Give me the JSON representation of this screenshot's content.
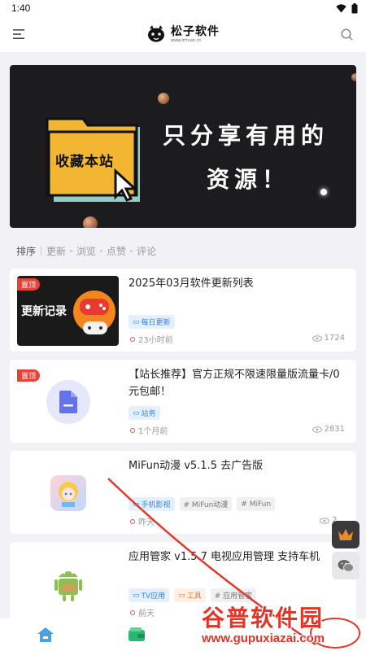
{
  "status": {
    "time": "1:40"
  },
  "header": {
    "title": "松子软件",
    "subtitle": "www.lrfruan.cn"
  },
  "banner": {
    "folder_label": "收藏本站",
    "line1": "只分享有用的",
    "line2": "资源！"
  },
  "sort": {
    "label": "排序",
    "options": [
      "更新",
      "浏览",
      "点赞",
      "评论"
    ]
  },
  "pin_label": "置顶",
  "posts": [
    {
      "title": "2025年03月软件更新列表",
      "thumb_text": "更新记录",
      "tags": [
        "每日更新"
      ],
      "time": "23小时前",
      "views": "1724",
      "pinned": true
    },
    {
      "title": "【站长推荐】官方正规不限速限量版流量卡/0元包邮！",
      "tags": [
        "站务"
      ],
      "time": "1个月前",
      "views": "2831",
      "pinned": true
    },
    {
      "title": "MiFun动漫 v5.1.5 去广告版",
      "tags": [
        "手机影视",
        "# MiFun动漫",
        "# MiFun"
      ],
      "time": "昨天",
      "views": "2...",
      "pinned": false
    },
    {
      "title": "应用管家 v1.5.7 电视应用管理 支持车机",
      "tags": [
        "TV应用",
        "工具",
        "# 应用管家"
      ],
      "time": "前天",
      "views": "",
      "pinned": false
    }
  ],
  "watermark": {
    "title": "谷普软件园",
    "url": "www.gupuxiazai.com"
  },
  "colors": {
    "accent": "#3b82d9",
    "pin": "#e2443b",
    "watermark": "#e53325",
    "banner_bg": "#1c1c1f",
    "folder": "#f2b632"
  }
}
